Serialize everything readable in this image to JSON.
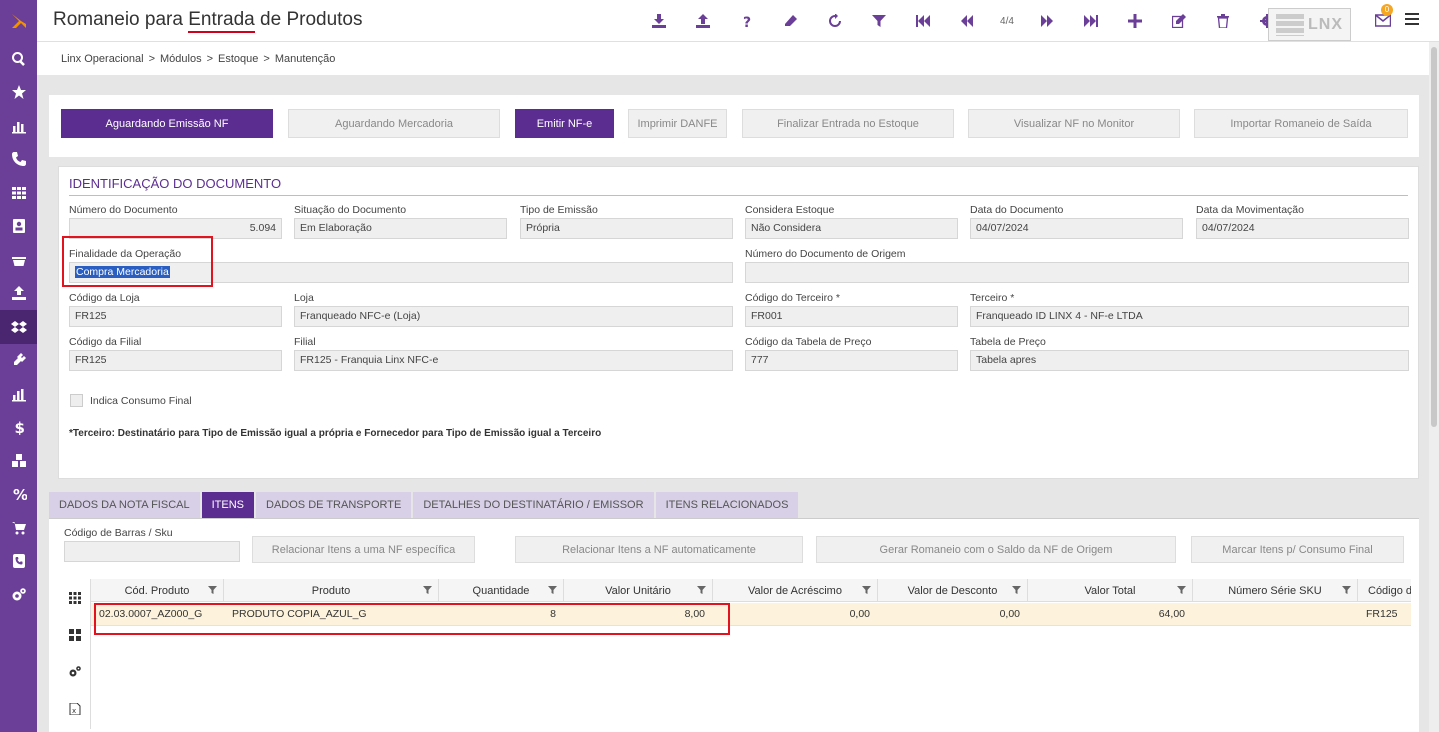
{
  "header": {
    "title_pre": "Romaneio para ",
    "title_mid": "Entrada",
    "title_post": " de Produtos",
    "page_counter": "4/4",
    "logo_text": "LNX",
    "notifications": "0"
  },
  "breadcrumb": [
    "Linx Operacional",
    "Módulos",
    "Estoque",
    "Manutenção"
  ],
  "breadcrumb_sep": ">",
  "actions": {
    "aguardando_emissao": "Aguardando Emissão NF",
    "aguardando_mercadoria": "Aguardando Mercadoria",
    "emitir_nfe": "Emitir NF-e",
    "imprimir_danfe": "Imprimir DANFE",
    "finalizar_entrada": "Finalizar Entrada no Estoque",
    "visualizar_nf": "Visualizar NF no Monitor",
    "importar_romaneio": "Importar Romaneio de Saída"
  },
  "identificacao": {
    "title": "IDENTIFICAÇÃO DO DOCUMENTO",
    "numero_documento": {
      "label": "Número do Documento",
      "value": "5.094"
    },
    "situacao": {
      "label": "Situação do Documento",
      "value": "Em Elaboração"
    },
    "tipo_emissao": {
      "label": "Tipo de Emissão",
      "value": "Própria"
    },
    "considera_estoque": {
      "label": "Considera Estoque",
      "value": "Não Considera"
    },
    "data_documento": {
      "label": "Data do Documento",
      "value": "04/07/2024"
    },
    "data_movimentacao": {
      "label": "Data da Movimentação",
      "value": "04/07/2024"
    },
    "finalidade": {
      "label": "Finalidade da Operação",
      "value": "Compra Mercadoria"
    },
    "doc_origem": {
      "label": "Número do Documento de Origem",
      "value": ""
    },
    "codigo_loja": {
      "label": "Código da Loja",
      "value": "FR125"
    },
    "loja": {
      "label": "Loja",
      "value": "Franqueado NFC-e (Loja)"
    },
    "codigo_terceiro": {
      "label": "Código do Terceiro *",
      "value": "FR001"
    },
    "terceiro": {
      "label": "Terceiro *",
      "value": "Franqueado ID LINX 4 - NF-e LTDA"
    },
    "codigo_filial": {
      "label": "Código da Filial",
      "value": "FR125"
    },
    "filial": {
      "label": "Filial",
      "value": "FR125 - Franquia Linx NFC-e"
    },
    "codigo_tabela": {
      "label": "Código da Tabela de Preço",
      "value": "777"
    },
    "tabela_preco": {
      "label": "Tabela de Preço",
      "value": "Tabela apres"
    },
    "consumo_final": "Indica Consumo Final",
    "note": "*Terceiro: Destinatário para Tipo de Emissão igual a própria e Fornecedor para Tipo de Emissão igual a Terceiro"
  },
  "tabs": [
    "DADOS DA NOTA FISCAL",
    "ITENS",
    "DADOS DE TRANSPORTE",
    "DETALHES DO DESTINATÁRIO / EMISSOR",
    "ITENS RELACIONADOS"
  ],
  "itens": {
    "sku_label": "Código de Barras / Sku",
    "btn_relacionar_nf": "Relacionar Itens a uma NF específica",
    "btn_relacionar_auto": "Relacionar Itens a NF automaticamente",
    "btn_gerar_romaneio": "Gerar Romaneio com o Saldo da NF de Origem",
    "btn_marcar_consumo": "Marcar Itens p/ Consumo Final",
    "columns": [
      "Cód. Produto",
      "Produto",
      "Quantidade",
      "Valor Unitário",
      "Valor de Acréscimo",
      "Valor de Desconto",
      "Valor Total",
      "Número Série SKU",
      "Código d"
    ],
    "rows": [
      [
        "02.03.0007_AZ000_G",
        "PRODUTO COPIA_AZUL_G",
        "8",
        "8,00",
        "0,00",
        "0,00",
        "64,00",
        "",
        "FR125"
      ]
    ]
  }
}
